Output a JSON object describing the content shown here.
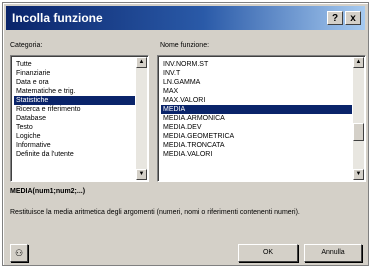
{
  "window": {
    "title": "Incolla funzione",
    "help_glyph": "?",
    "close_glyph": "x"
  },
  "labels": {
    "category": "Categoria:",
    "function_name": "Nome funzione:"
  },
  "categories": {
    "items": [
      {
        "label": "Tutte"
      },
      {
        "label": "Finanziarie"
      },
      {
        "label": "Data e ora"
      },
      {
        "label": "Matematiche e trig."
      },
      {
        "label": "Statistiche",
        "selected": true
      },
      {
        "label": "Ricerca e riferimento"
      },
      {
        "label": "Database"
      },
      {
        "label": "Testo"
      },
      {
        "label": "Logiche"
      },
      {
        "label": "Informative"
      },
      {
        "label": "Definite da l'utente"
      }
    ]
  },
  "functions": {
    "items": [
      {
        "label": "INV.NORM.ST"
      },
      {
        "label": "INV.T"
      },
      {
        "label": "LN.GAMMA"
      },
      {
        "label": "MAX"
      },
      {
        "label": "MAX.VALORI"
      },
      {
        "label": "MEDIA",
        "selected": true
      },
      {
        "label": "MEDIA.ARMONICA"
      },
      {
        "label": "MEDIA.DEV"
      },
      {
        "label": "MEDIA.GEOMETRICA"
      },
      {
        "label": "MEDIA.TRONCATA"
      },
      {
        "label": "MEDIA.VALORI"
      }
    ]
  },
  "syntax": "MEDIA(num1;num2;...)",
  "description": "Restituisce la media aritmetica degli argomenti (numeri, nomi o riferimenti contenenti numeri).",
  "buttons": {
    "ok": "OK",
    "cancel": "Annulla"
  },
  "icons": {
    "help_button": "office-assistant-icon",
    "scroll_up": "arrow-up-icon",
    "scroll_down": "arrow-down-icon"
  }
}
